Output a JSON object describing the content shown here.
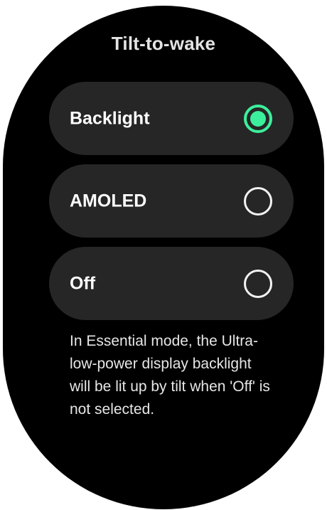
{
  "screen": {
    "title": "Tilt-to-wake"
  },
  "options": [
    {
      "label": "Backlight",
      "selected": true
    },
    {
      "label": "AMOLED",
      "selected": false
    },
    {
      "label": "Off",
      "selected": false
    }
  ],
  "description": "In Essential mode, the Ultra-low-power display backlight will be lit up by tilt when 'Off' is not selected.",
  "colors": {
    "background": "#000000",
    "option_background": "#262626",
    "accent": "#3cef9c",
    "text": "#ffffff"
  }
}
